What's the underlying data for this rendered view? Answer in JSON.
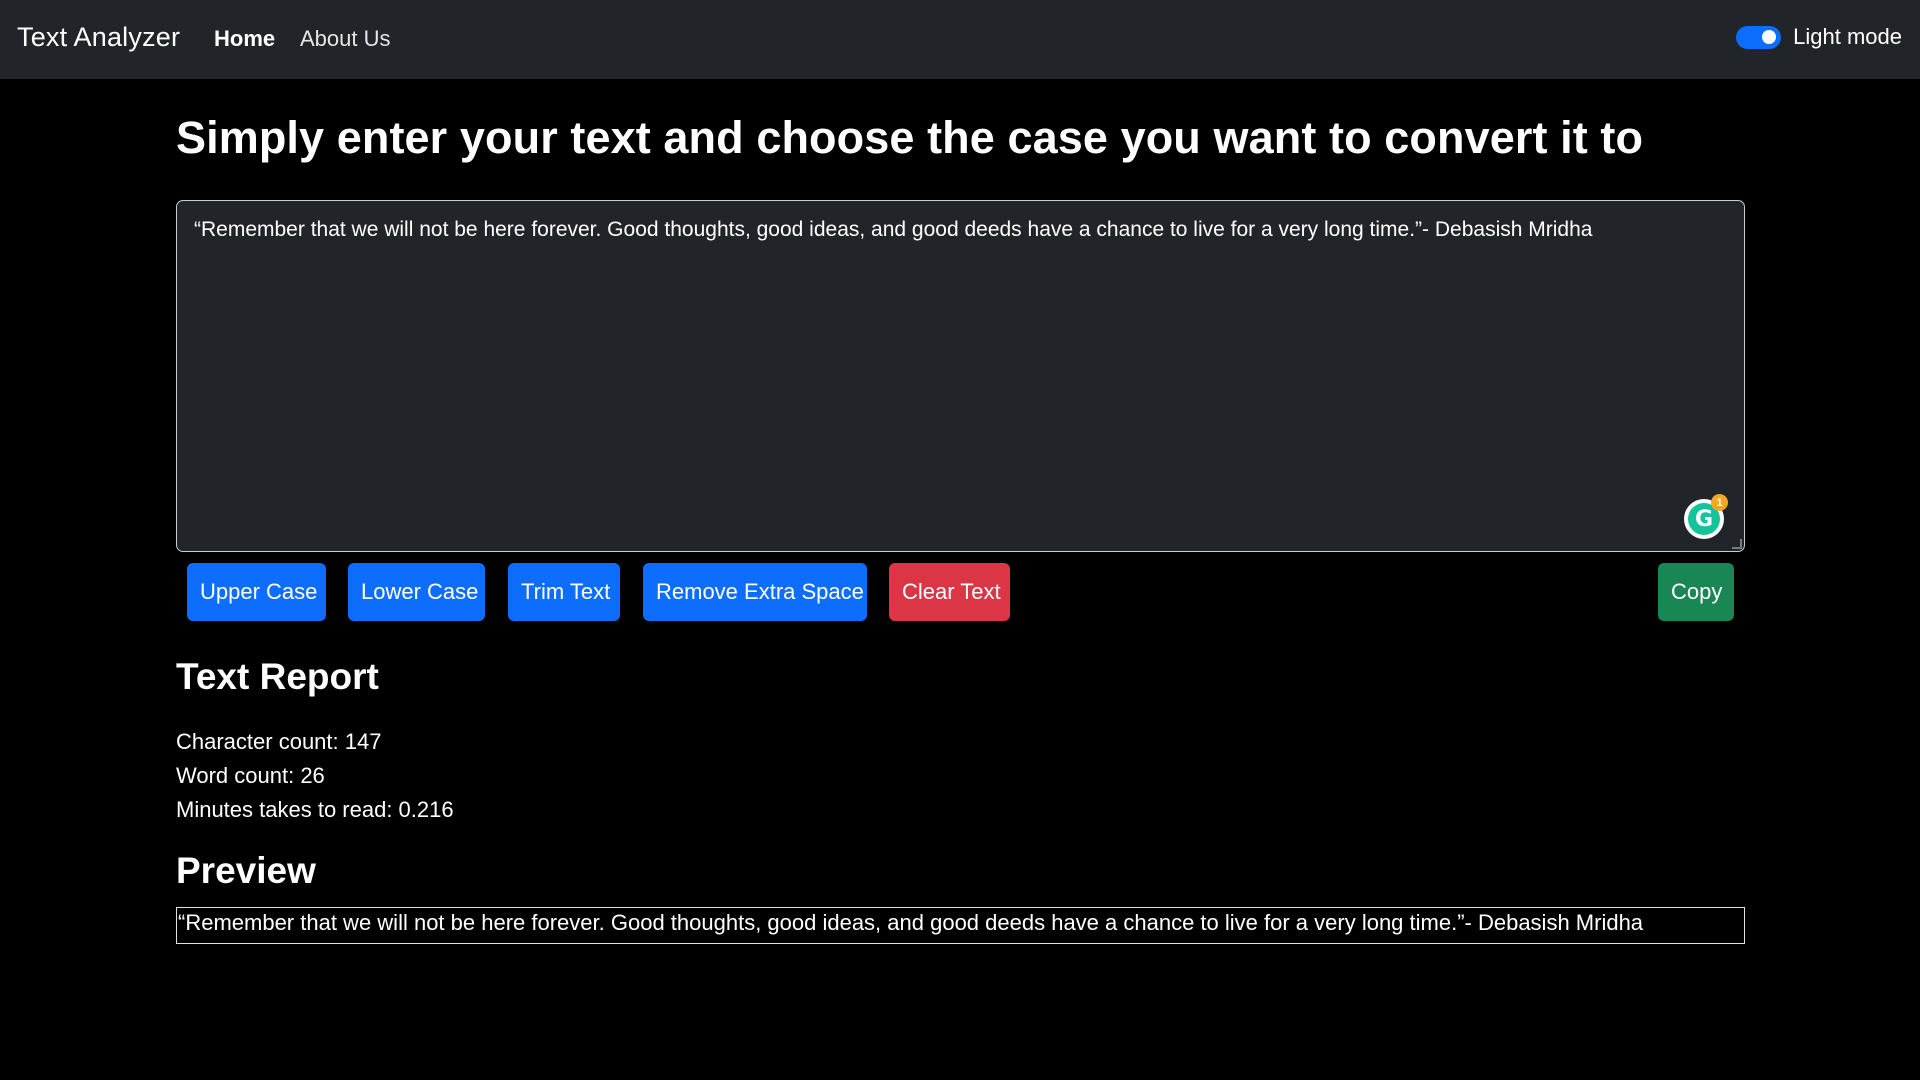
{
  "navbar": {
    "brand": "Text Analyzer",
    "links": [
      {
        "label": "Home",
        "active": true
      },
      {
        "label": "About Us",
        "active": false
      }
    ],
    "mode_toggle": {
      "label": "Light mode",
      "checked": true,
      "accent": "#0d6efd"
    }
  },
  "main": {
    "title": "Simply enter your text and choose the case you want to convert it to",
    "textarea_value": "“Remember that we will not be here forever. Good thoughts, good ideas, and good deeds have a chance to live for a very long time.”- Debasish Mridha",
    "grammarly_badge_count": "1",
    "buttons": {
      "upper": "Upper Case",
      "lower": "Lower Case",
      "trim": "Trim Text",
      "extra_space": "Remove Extra Space",
      "clear": "Clear Text",
      "copy": "Copy"
    },
    "report": {
      "heading": "Text Report",
      "characters": "Character count: 147",
      "words": "Word count: 26",
      "minutes": "Minutes takes to read: 0.216"
    },
    "preview": {
      "heading": "Preview",
      "text": "“Remember that we will not be here forever. Good thoughts, good ideas, and good deeds have a chance to live for a very long time.”- Debasish Mridha"
    }
  },
  "colors": {
    "page_background": "#000000",
    "navbar_background": "#212529",
    "primary": "#0d6efd",
    "danger": "#dc3545",
    "success": "#198754"
  }
}
